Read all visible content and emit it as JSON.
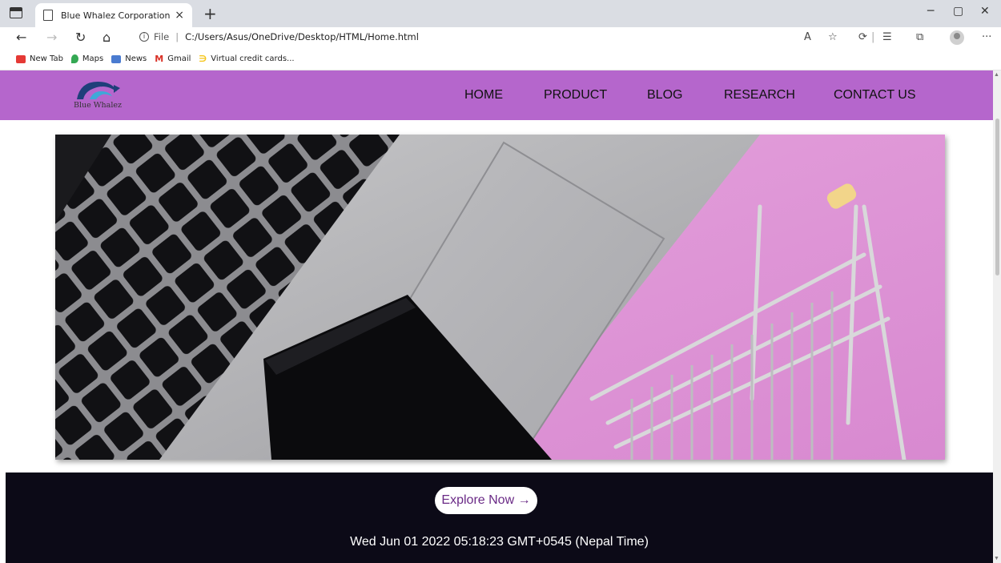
{
  "browser": {
    "tab_title": "Blue Whalez Corporation",
    "tab_close": "×",
    "new_tab": "+",
    "address_prefix": "File",
    "address_sep": "|",
    "address": "C:/Users/Asus/OneDrive/Desktop/HTML/Home.html",
    "bookmarks": [
      {
        "label": "New Tab",
        "color": "#e53935"
      },
      {
        "label": "Maps",
        "color": "#34a853"
      },
      {
        "label": "News",
        "color": "#4a7bd0"
      },
      {
        "label": "Gmail",
        "color": "#d93025"
      },
      {
        "label": "Virtual credit cards...",
        "color": "#f5c518"
      }
    ]
  },
  "site": {
    "logo_text": "Blue Whalez",
    "nav": [
      "HOME",
      "PRODUCT",
      "BLOG",
      "RESEARCH",
      "CONTACT US"
    ],
    "nav_bg": "#b566cc",
    "explore_label": "Explore Now →",
    "datetime": "Wed Jun 01 2022 05:18:23 GMT+0545 (Nepal Time)",
    "footer_bg": "#0c0a17"
  }
}
